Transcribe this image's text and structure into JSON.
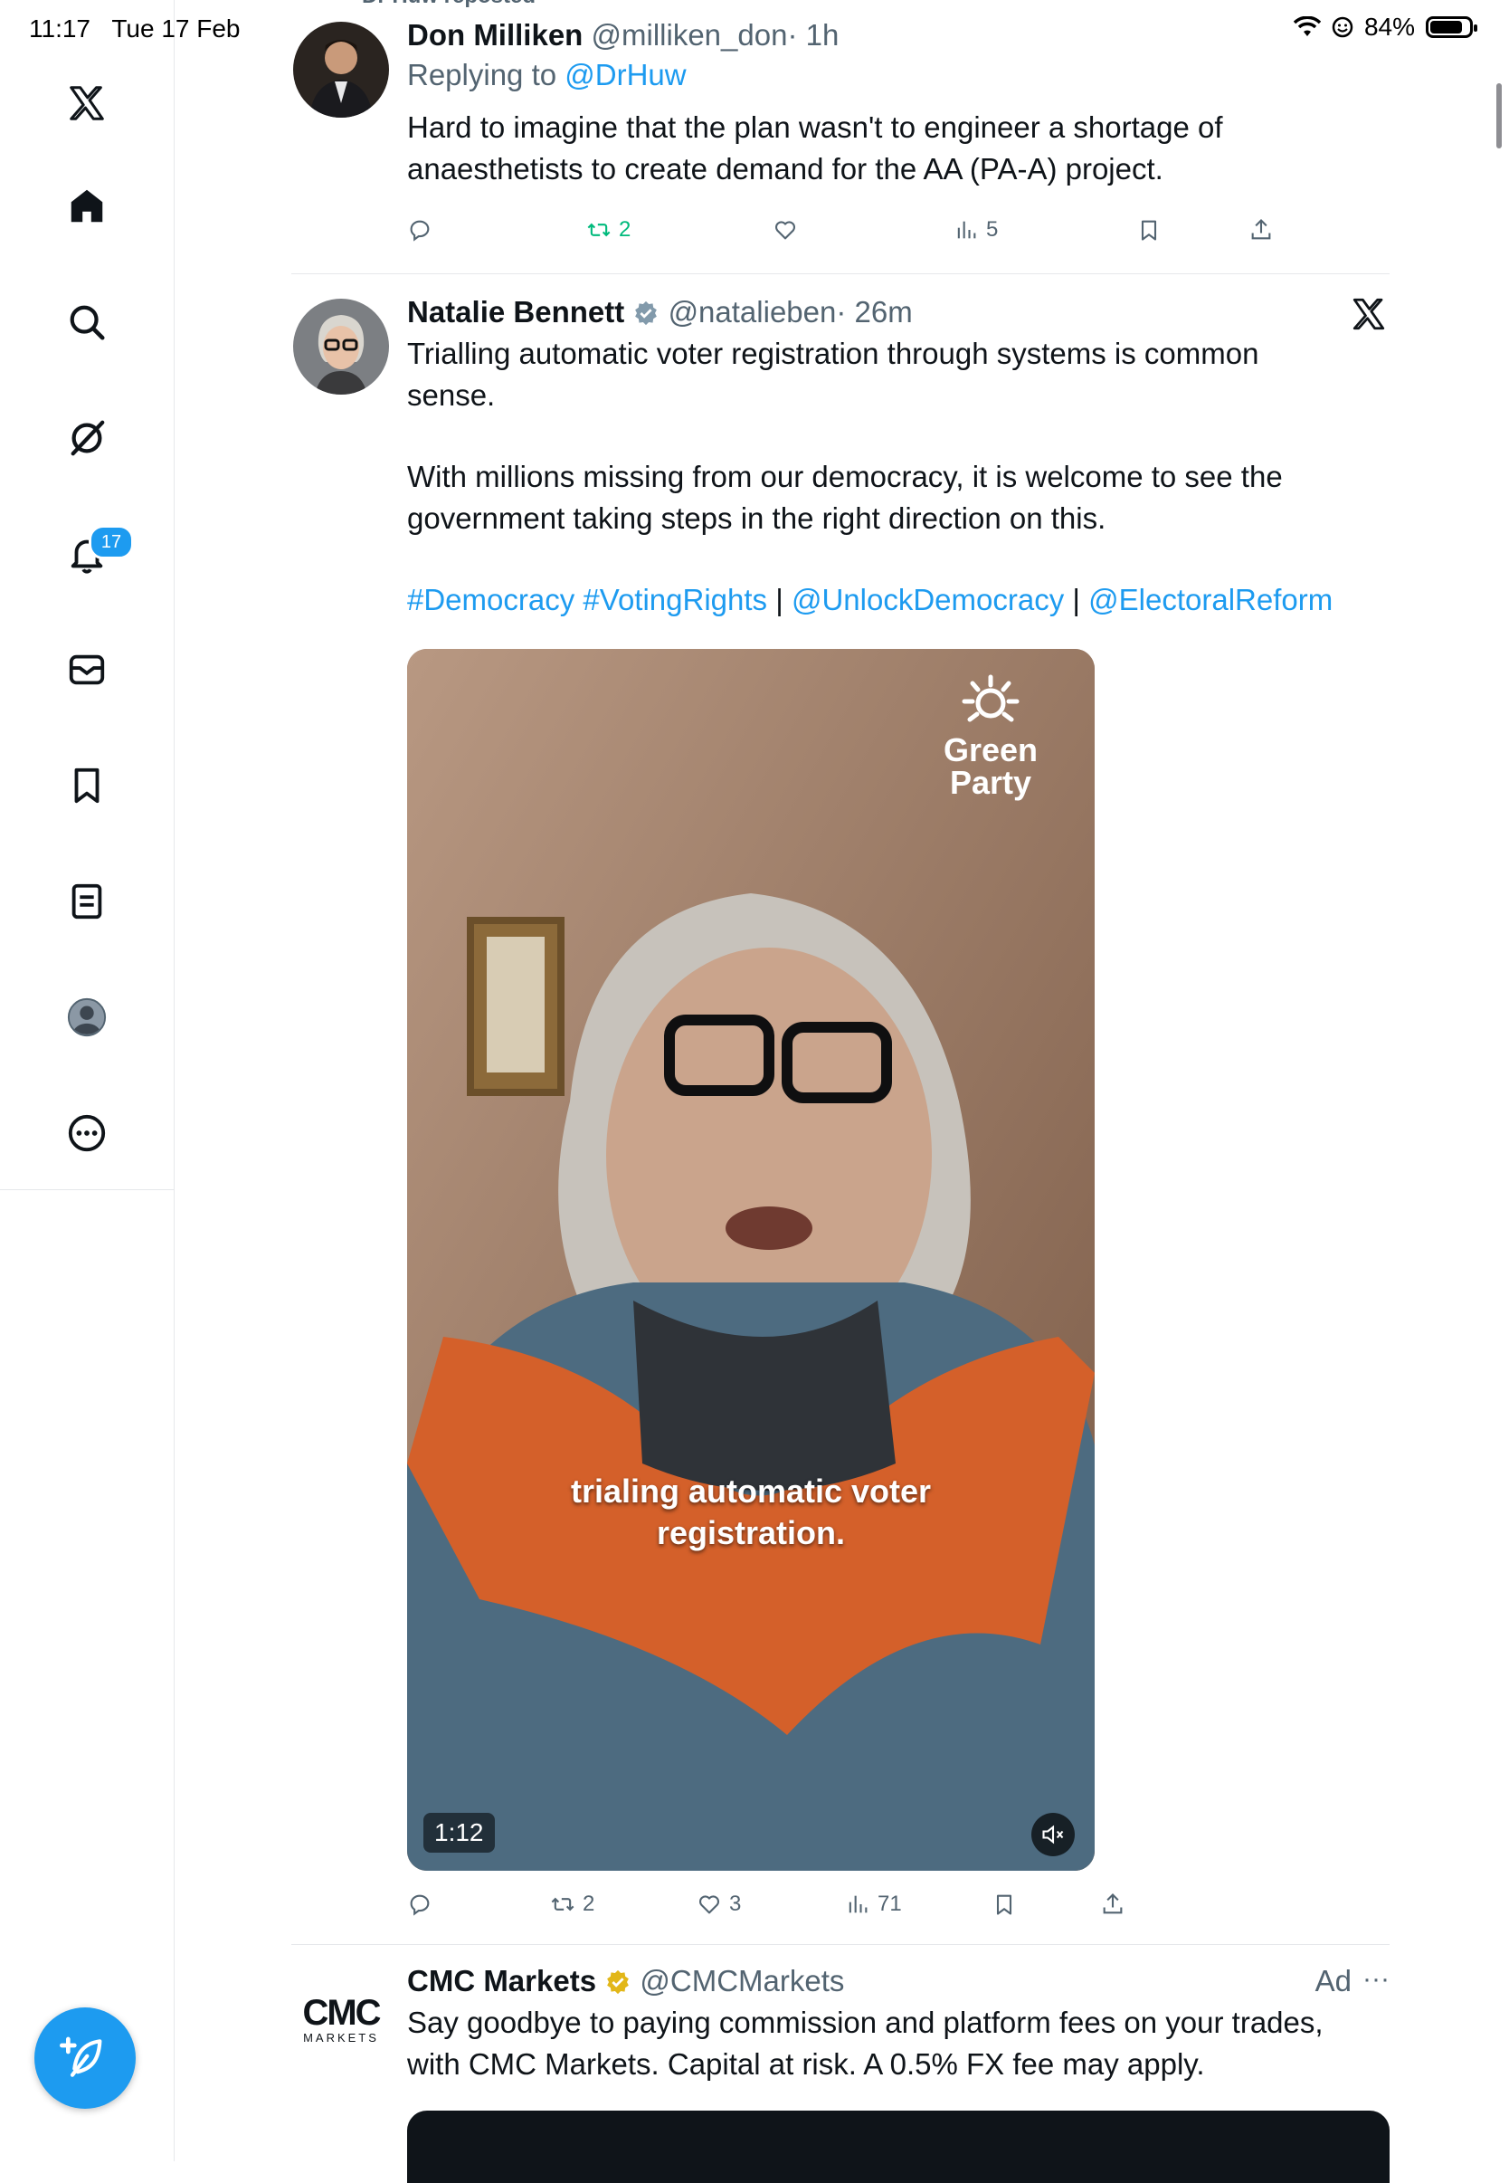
{
  "status_bar": {
    "time": "11:17",
    "date": "Tue 17 Feb",
    "battery_text": "84%",
    "battery_level": 0.84
  },
  "sidebar": {
    "items": [
      {
        "name": "x-logo-icon"
      },
      {
        "name": "home-icon"
      },
      {
        "name": "search-icon"
      },
      {
        "name": "grok-icon"
      },
      {
        "name": "notifications-icon",
        "badge": "17"
      },
      {
        "name": "messages-icon"
      },
      {
        "name": "bookmarks-icon"
      },
      {
        "name": "lists-icon"
      },
      {
        "name": "profile-icon"
      },
      {
        "name": "more-icon"
      }
    ],
    "compose_icon": "compose-feather-icon"
  },
  "timeline": {
    "repost_note": "Dr Huw reposted",
    "tweets": [
      {
        "name": "Don Milliken",
        "handle": "@milliken_don",
        "time": "· 1h",
        "replying_prefix": "Replying to",
        "replying_handle": "@DrHuw",
        "text": "Hard to imagine that the plan wasn't to engineer a shortage of anaesthetists to create demand for the AA (PA-A) project.",
        "reposts": "2",
        "views": "5"
      },
      {
        "name": "Natalie Bennett",
        "verified": true,
        "handle": "@natalieben",
        "time": "· 26m",
        "text_p1": "Trialling automatic voter registration through systems is common sense.",
        "text_p2": "With millions missing from our democracy, it is welcome to see the government taking steps in the right direction on this.",
        "tags": [
          "#Democracy",
          "#VotingRights",
          "@UnlockDemocracy",
          "@ElectoralReform"
        ],
        "separator": "|",
        "video": {
          "logo_line1": "Green",
          "logo_line2": "Party",
          "caption_line1": "trialing automatic voter",
          "caption_line2": "registration.",
          "duration": "1:12"
        },
        "reposts": "2",
        "likes": "3",
        "views": "71"
      },
      {
        "name": "CMC Markets",
        "verified_gold": true,
        "handle": "@CMCMarkets",
        "ad_label": "Ad",
        "more": "···",
        "logo_text": "CMC",
        "logo_sub": "MARKETS",
        "text": "Say goodbye to paying commission and platform fees on your trades, with CMC Markets. Capital at risk.  A 0.5% FX fee may apply."
      }
    ]
  },
  "colors": {
    "accent": "#1d9bf0",
    "repost_green": "#00ba7c",
    "secondary_text": "#536471",
    "gold": "#e2b719"
  }
}
